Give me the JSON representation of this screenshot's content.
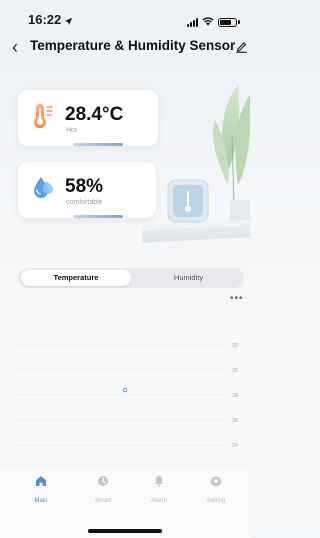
{
  "status_bar": {
    "time": "16:22"
  },
  "header": {
    "title": "Temperature & Humidity Sensor"
  },
  "temperature_card": {
    "value": "28.4°C",
    "status": "Hot"
  },
  "humidity_card": {
    "value": "58%",
    "status": "comfortable"
  },
  "tabs": [
    {
      "label": "Temperature",
      "selected": true
    },
    {
      "label": "Humidity",
      "selected": false
    }
  ],
  "chart_data": {
    "type": "scatter",
    "y_ticks": [
      "32",
      "30",
      "28",
      "26",
      "24"
    ],
    "points": [
      {
        "y": 28.4
      }
    ]
  },
  "bottom_nav": [
    {
      "label": "Main",
      "icon": "home-icon",
      "active": true
    },
    {
      "label": "Smart",
      "icon": "clock-icon",
      "active": false
    },
    {
      "label": "Alarm",
      "icon": "bell-icon",
      "active": false
    },
    {
      "label": "Setting",
      "icon": "gear-icon",
      "active": false
    }
  ],
  "colors": {
    "accent": "#5b8cc9",
    "inactive": "#c3c7cc"
  }
}
